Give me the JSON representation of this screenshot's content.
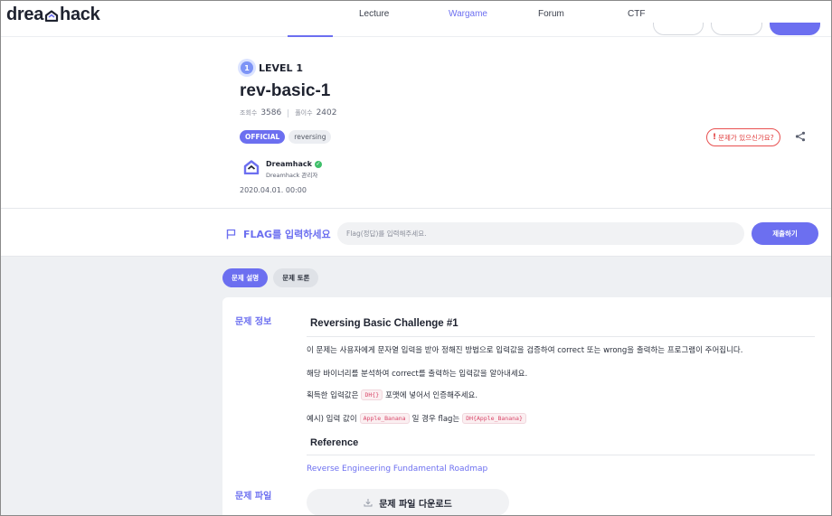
{
  "nav": {
    "logo_left": "drea",
    "logo_right": "hack",
    "items": [
      {
        "label": "Lecture"
      },
      {
        "label": "Wargame"
      },
      {
        "label": "Forum"
      },
      {
        "label": "CTF"
      }
    ],
    "active_item": "Wargame"
  },
  "challenge": {
    "level_number": "1",
    "level_label": "LEVEL 1",
    "title": "rev-basic-1",
    "views_label": "조회수",
    "views": "3586",
    "solves_label": "풀이수",
    "solves": "2402",
    "tags": [
      "OFFICIAL",
      "reversing"
    ],
    "author_name": "Dreamhack",
    "author_role": "Dreamhack 관리자",
    "date": "2020.04.01. 00:00",
    "report_label": "문제가 있으신가요?"
  },
  "flag": {
    "label": "FLAG를 입력하세요",
    "placeholder": "Flag(정답)를 입력해주세요.",
    "submit_label": "제출하기"
  },
  "tabs": [
    {
      "label": "문제 설명"
    },
    {
      "label": "문제 토론"
    }
  ],
  "description": {
    "section_label": "문제 정보",
    "heading": "Reversing Basic Challenge #1",
    "para1": "이 문제는 사용자에게 문자열 입력을 받아 정해진 방법으로 입력값을 검증하여 correct 또는 wrong을 출력하는 프로그램이 주어집니다.",
    "para2": "해당 바이너리를 분석하여 correct를 출력하는 입력값을 알아내세요.",
    "para3_pre": "획득한 입력값은",
    "para3_code": "DH{}",
    "para3_post": "포맷에 넣어서 인증해주세요.",
    "para4_pre": "예시) 입력 값이",
    "para4_code1": "Apple_Banana",
    "para4_mid": "일 경우 flag는",
    "para4_code2": "DH{Apple_Banana}",
    "reference_heading": "Reference",
    "reference_link": "Reverse Engineering Fundamental Roadmap"
  },
  "files": {
    "section_label": "문제 파일",
    "download_label": "문제 파일 다운로드"
  },
  "colors": {
    "accent": "#6c6ff0",
    "danger": "#e03a3a",
    "code": "#d9486a",
    "verified": "#3fbf6a"
  }
}
